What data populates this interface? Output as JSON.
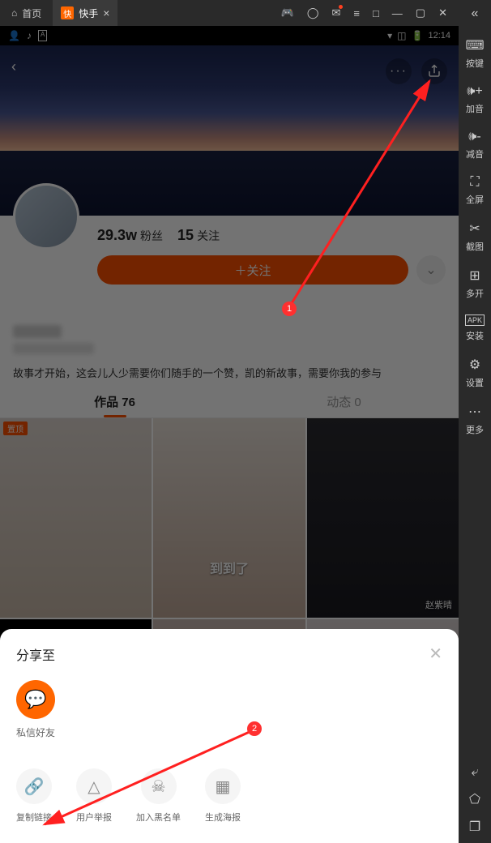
{
  "titlebar": {
    "home_label": "首页",
    "tab_label": "快手"
  },
  "statusbar": {
    "time": "12:14"
  },
  "sidebar": {
    "items": [
      {
        "icon": "⌨",
        "label": "按键"
      },
      {
        "icon": "🔊+",
        "label": "加音"
      },
      {
        "icon": "🔊-",
        "label": "减音"
      },
      {
        "icon": "⛶",
        "label": "全屏"
      },
      {
        "icon": "✂",
        "label": "截图"
      },
      {
        "icon": "⊕",
        "label": "多开"
      },
      {
        "icon": "APK",
        "label": "安装"
      },
      {
        "icon": "⚙",
        "label": "设置"
      },
      {
        "icon": "⋯",
        "label": "更多"
      }
    ]
  },
  "profile": {
    "fans_count": "29.3w",
    "fans_label": "粉丝",
    "follow_count": "15",
    "follow_label": "关注",
    "follow_btn": "＋关注",
    "bio": "故事才开始，这会儿人少需要你们随手的一个赞，凯的新故事，需要你我的参与",
    "gender": "男",
    "location": "北京 东城区"
  },
  "tabs": {
    "works": "作品 76",
    "updates": "动态 0"
  },
  "grid": {
    "pin": "置顶",
    "caption2": "到到了",
    "name3": "赵紫晴"
  },
  "sheet": {
    "title": "分享至",
    "friend_label": "私信好友",
    "actions": [
      {
        "icon": "🔗",
        "label": "复制链接"
      },
      {
        "icon": "⚠",
        "label": "用户举报"
      },
      {
        "icon": "☠",
        "label": "加入黑名单"
      },
      {
        "icon": "▣",
        "label": "生成海报"
      }
    ]
  },
  "annotations": {
    "n1": "1",
    "n2": "2"
  }
}
